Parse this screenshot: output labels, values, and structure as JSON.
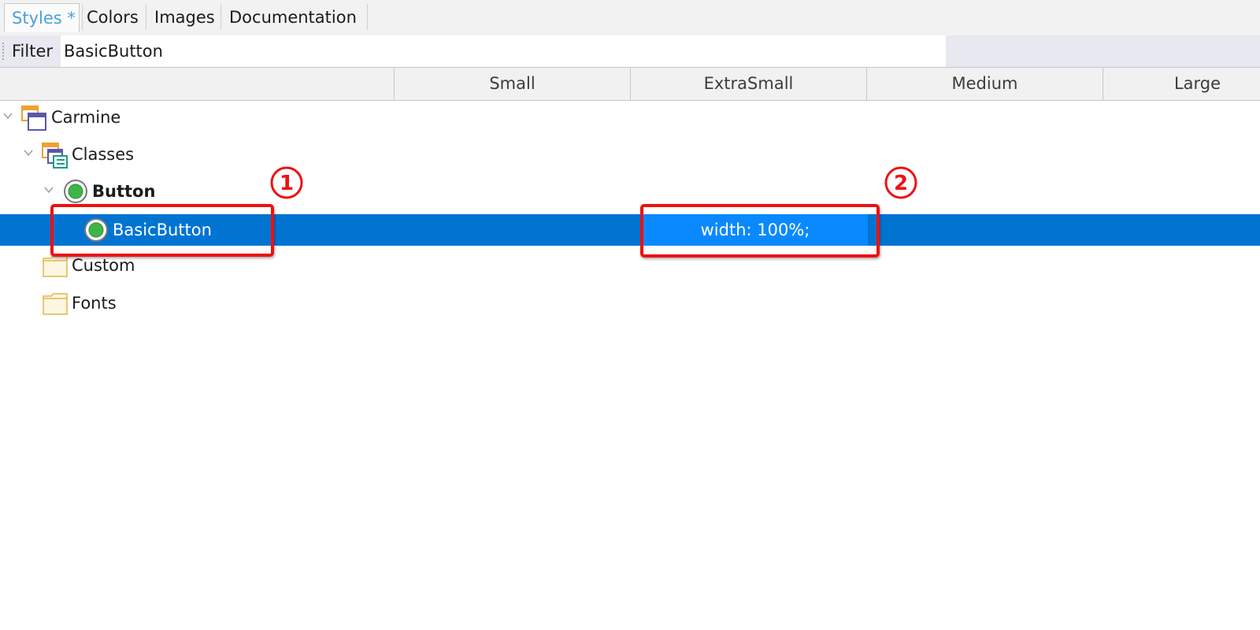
{
  "tabs": [
    {
      "label": "Styles *",
      "active": true
    },
    {
      "label": "Colors",
      "active": false
    },
    {
      "label": "Images",
      "active": false
    },
    {
      "label": "Documentation",
      "active": false
    }
  ],
  "filter": {
    "label": "Filter",
    "value": "BasicButton"
  },
  "columns": [
    "",
    "Small",
    "ExtraSmall",
    "Medium",
    "Large"
  ],
  "tree": [
    {
      "label": "Carmine",
      "icon": "theme-object-icon",
      "expanded": true,
      "bold": false
    },
    {
      "label": "Classes",
      "icon": "classes-icon",
      "expanded": true,
      "bold": false
    },
    {
      "label": "Button",
      "icon": "class-circle-icon",
      "expanded": true,
      "bold": true
    },
    {
      "label": "BasicButton",
      "icon": "class-circle-icon",
      "selected": true,
      "bold": false,
      "cells": {
        "ExtraSmall": "width: 100%;"
      }
    },
    {
      "label": "Custom",
      "icon": "folder-icon",
      "bold": false
    },
    {
      "label": "Fonts",
      "icon": "folder-icon",
      "bold": false
    }
  ],
  "annotations": [
    {
      "number": "1"
    },
    {
      "number": "2"
    }
  ],
  "colors": {
    "selection": "#0174d2",
    "cell_highlight": "#0a89ff",
    "callout": "#ee1111",
    "active_tab_text": "#4a9fd8"
  }
}
